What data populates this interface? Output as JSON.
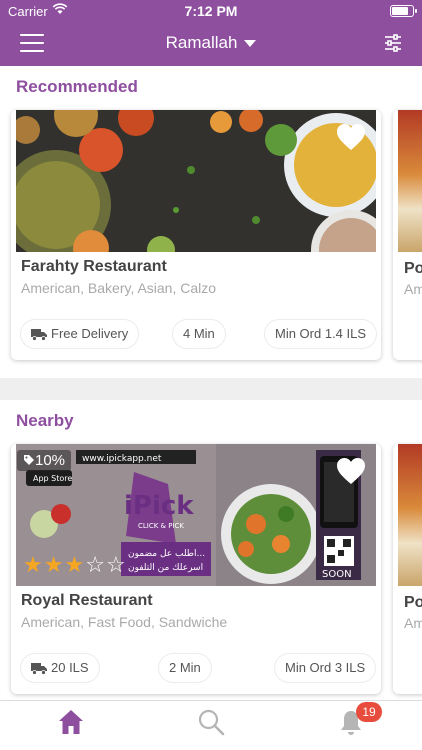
{
  "status_bar": {
    "carrier": "Carrier",
    "time": "7:12 PM",
    "battery_level": 0.85
  },
  "header": {
    "city": "Ramallah"
  },
  "colors": {
    "brand": "#8e4f9f",
    "star": "#f5a623",
    "badge": "#e74c3c"
  },
  "sections": {
    "recommended": {
      "title": "Recommended",
      "card": {
        "name": "Farahty Restaurant",
        "categories": "American, Bakery, Asian, Calzo",
        "delivery": "Free Delivery",
        "time": "4 Min",
        "min_order": "Min Ord 1.4 ILS",
        "favorite": true
      },
      "peek": {
        "name": "Po",
        "categories": "Am"
      }
    },
    "nearby": {
      "title": "Nearby",
      "card": {
        "name": "Royal Restaurant",
        "categories": "American, Fast Food, Sandwiche",
        "discount": "10%",
        "rating": 3,
        "rating_max": 5,
        "delivery": "20 ILS",
        "time": "2 Min",
        "min_order": "Min Ord 3 ILS",
        "favorite": true,
        "ad_text": {
          "url": "www.ipickapp.net",
          "store": "App Store",
          "brand": "iPick",
          "tagline": "CLICK & PICK",
          "arabic_1": "اطلب عل مضمون...",
          "arabic_2": "اسرعلك من التلفون",
          "soon": "SOON"
        }
      },
      "peek": {
        "name": "Po",
        "categories": "Am"
      }
    }
  },
  "tabbar": {
    "notification_count": "19"
  },
  "icons": [
    "menu-icon",
    "filter-icon",
    "heart-icon",
    "truck-icon",
    "tag-icon",
    "star-icon",
    "home-icon",
    "search-icon",
    "bell-icon",
    "wifi-icon",
    "battery-icon"
  ]
}
